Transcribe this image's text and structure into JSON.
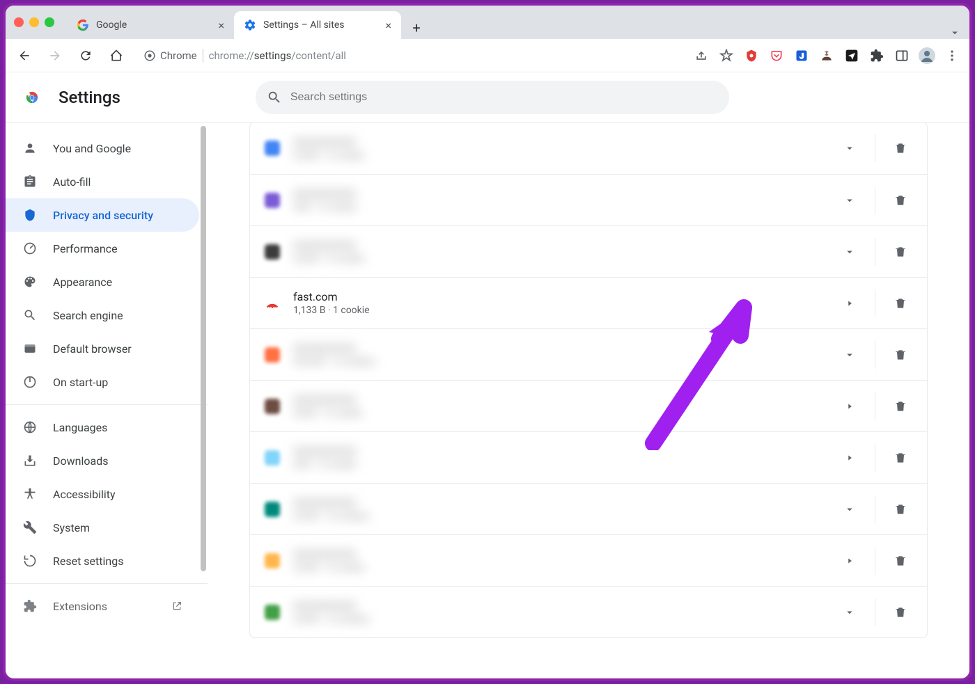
{
  "window": {
    "tabs": [
      {
        "label": "Google",
        "favicon": "google",
        "active": false
      },
      {
        "label": "Settings – All sites",
        "favicon": "gear",
        "active": true
      }
    ]
  },
  "toolbar": {
    "chip_label": "Chrome",
    "url_prefix": "chrome://",
    "url_dark": "settings",
    "url_suffix": "/content/all"
  },
  "header": {
    "title": "Settings",
    "search_placeholder": "Search settings"
  },
  "sidebar": {
    "items": [
      {
        "icon": "person",
        "label": "You and Google"
      },
      {
        "icon": "clipboard",
        "label": "Auto-fill"
      },
      {
        "icon": "shield",
        "label": "Privacy and security",
        "active": true
      },
      {
        "icon": "gauge",
        "label": "Performance"
      },
      {
        "icon": "palette",
        "label": "Appearance"
      },
      {
        "icon": "search",
        "label": "Search engine"
      },
      {
        "icon": "browser",
        "label": "Default browser"
      },
      {
        "icon": "power",
        "label": "On start-up"
      }
    ],
    "items2": [
      {
        "icon": "globe",
        "label": "Languages"
      },
      {
        "icon": "download",
        "label": "Downloads"
      },
      {
        "icon": "a11y",
        "label": "Accessibility"
      },
      {
        "icon": "wrench",
        "label": "System"
      },
      {
        "icon": "reset",
        "label": "Reset settings"
      }
    ],
    "items3": [
      {
        "icon": "puzzle",
        "label": "Extensions",
        "external": true
      }
    ]
  },
  "sites": [
    {
      "blurred": true,
      "icon_color": "#4285f4",
      "name": "XXXXXXXXX",
      "sub": "X,XXX · X cookie",
      "expand": "chevron"
    },
    {
      "blurred": true,
      "icon_color": "#7b5bd6",
      "name": "XXXXXXXXX",
      "sub": "XXX · X cookie",
      "expand": "chevron"
    },
    {
      "blurred": true,
      "icon_color": "#3c3c3c",
      "name": "XXXXXXXXX",
      "sub": "X,XXX · X cookie",
      "expand": "chevron"
    },
    {
      "blurred": false,
      "icon_color": "#e53935",
      "icon": "fast",
      "name": "fast.com",
      "sub": "1,133 B · 1 cookie",
      "expand": "triangle"
    },
    {
      "blurred": true,
      "icon_color": "#ff7043",
      "name": "XXXXXXXXX",
      "sub": "XX,XXX · X cookies",
      "expand": "chevron"
    },
    {
      "blurred": true,
      "icon_color": "#6d4c41",
      "name": "XXXXXXXXX",
      "sub": "XXXX · X cookie",
      "expand": "triangle"
    },
    {
      "blurred": true,
      "icon_color": "#81d4fa",
      "name": "XXXXXXXXX",
      "sub": "XXX · X cookie",
      "expand": "triangle"
    },
    {
      "blurred": true,
      "icon_color": "#00897b",
      "name": "XXXXXXXXX",
      "sub": "X,XXX · X cookies",
      "expand": "chevron"
    },
    {
      "blurred": true,
      "icon_color": "#ffb74d",
      "name": "XXXXXXXXX",
      "sub": "X,XXX · X cookie",
      "expand": "triangle"
    },
    {
      "blurred": true,
      "icon_color": "#43a047",
      "name": "XXXXXXXXX",
      "sub": "X,XXX · X cookies",
      "expand": "chevron"
    }
  ],
  "annotation": {
    "color": "#a020f0"
  }
}
